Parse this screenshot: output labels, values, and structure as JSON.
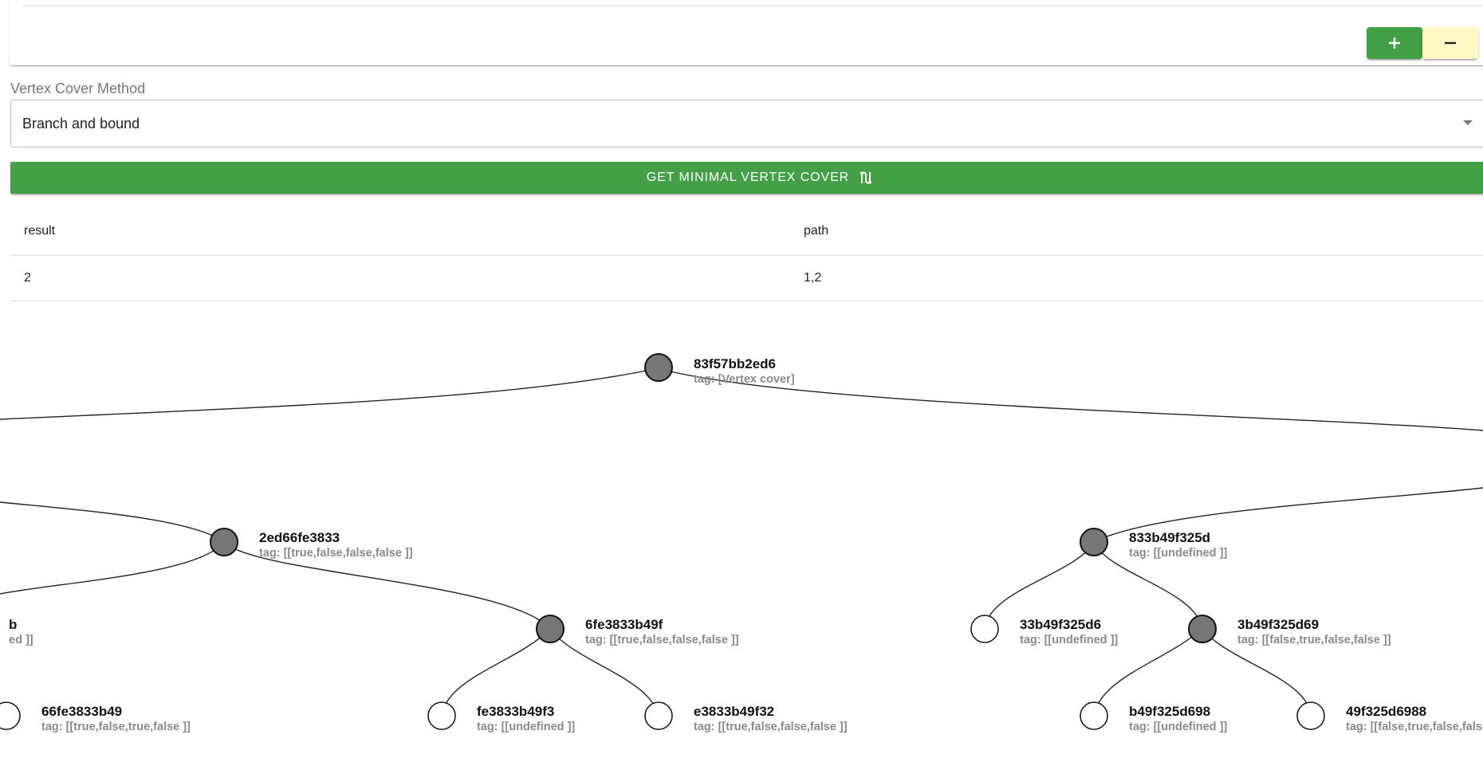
{
  "toolbar": {
    "add_icon": "plus-icon",
    "remove_icon": "minus-icon",
    "add_color": "#43a047",
    "remove_color": "#fff8c4"
  },
  "method": {
    "label": "Vertex Cover Method",
    "selected": "Branch and bound"
  },
  "action": {
    "label": "GET MINIMAL VERTEX COVER",
    "icon": "route-icon"
  },
  "results": {
    "headers": [
      "result",
      "path"
    ],
    "rows": [
      [
        "2",
        "1,2"
      ]
    ]
  },
  "tree": {
    "nodes": [
      {
        "name": "83f57bb2ed6",
        "tag": "tag: [Vertex cover]",
        "filled": true
      },
      {
        "name": "2ed66fe3833",
        "tag": "tag: [[true,false,false,false ]]",
        "filled": true
      },
      {
        "name": "833b49f325d",
        "tag": "tag: [[undefined ]]",
        "filled": true
      },
      {
        "name": "b",
        "tag": "ed ]]",
        "filled": true
      },
      {
        "name": "6fe3833b49f",
        "tag": "tag: [[true,false,false,false ]]",
        "filled": true
      },
      {
        "name": "33b49f325d6",
        "tag": "tag: [[undefined ]]",
        "filled": false
      },
      {
        "name": "3b49f325d69",
        "tag": "tag: [[false,true,false,false ]]",
        "filled": true
      },
      {
        "name": "66fe3833b49",
        "tag": "tag: [[true,false,true,false ]]",
        "filled": false
      },
      {
        "name": "fe3833b49f3",
        "tag": "tag: [[undefined ]]",
        "filled": false
      },
      {
        "name": "e3833b49f32",
        "tag": "tag: [[true,false,false,false ]]",
        "filled": false
      },
      {
        "name": "b49f325d698",
        "tag": "tag: [[undefined ]]",
        "filled": false
      },
      {
        "name": "49f325d6988",
        "tag": "tag: [[false,true,false,false ]]",
        "filled": false
      }
    ]
  }
}
